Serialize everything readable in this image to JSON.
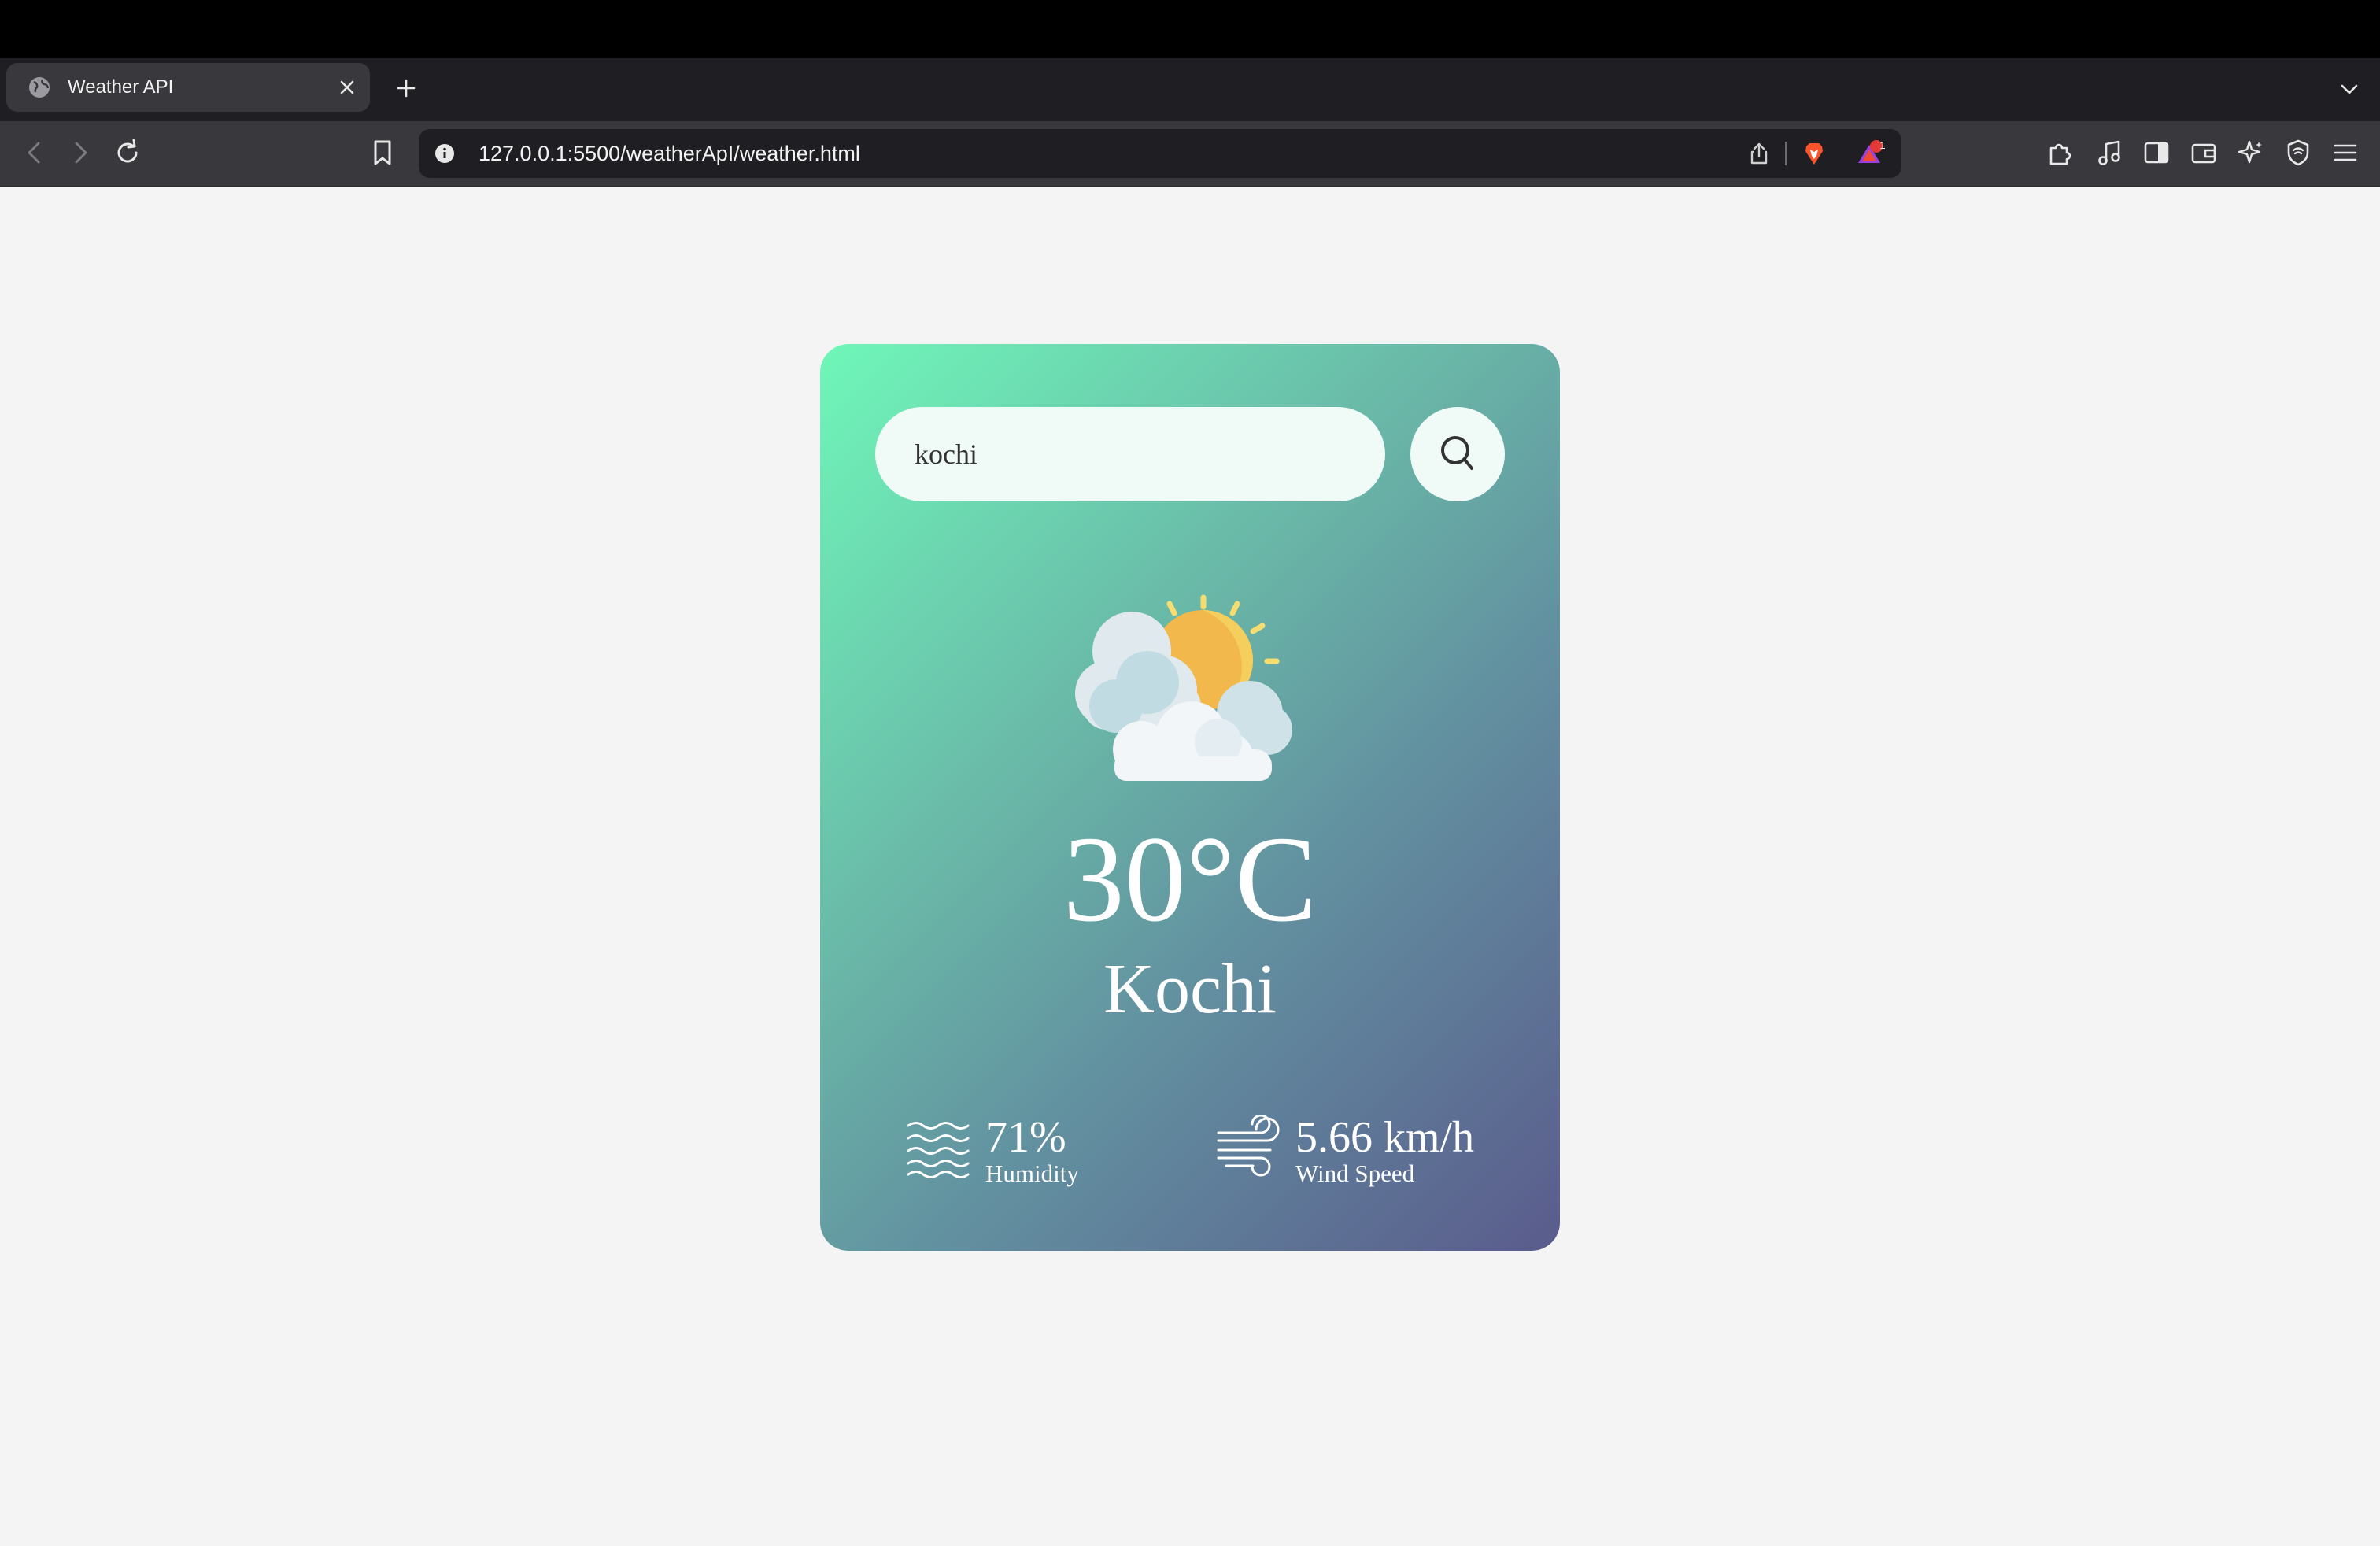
{
  "browser": {
    "tab": {
      "title": "Weather API"
    },
    "address_bar": {
      "url": "127.0.0.1:5500/weatherApI/weather.html"
    },
    "notification_badge": "1"
  },
  "weather_app": {
    "search": {
      "value": "kochi",
      "icon": "search-icon"
    },
    "condition_icon": "partly-cloudy-icon",
    "temperature": "30°C",
    "city": "Kochi",
    "humidity": {
      "value": "71%",
      "label": "Humidity",
      "icon": "humidity-icon"
    },
    "wind": {
      "value": "5.66 km/h",
      "label": "Wind Speed",
      "icon": "wind-icon"
    }
  },
  "colors": {
    "gradient_start": "#6ff7b9",
    "gradient_end": "#5a5b8c",
    "input_background": "#f0fbf8",
    "sun": "#f2b84b"
  }
}
